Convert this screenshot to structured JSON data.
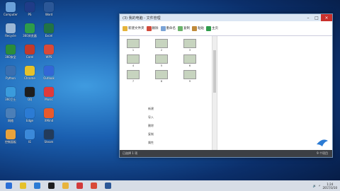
{
  "desktop": {
    "icons": [
      {
        "label": "Computer",
        "color": "#6aa0d9"
      },
      {
        "label": "Recycle",
        "color": "#9bb7d6"
      },
      {
        "label": "360安全",
        "color": "#2a8c3c"
      },
      {
        "label": "Python",
        "color": "#3a6fb0"
      },
      {
        "label": "360卫士",
        "color": "#3a9bdc"
      },
      {
        "label": "网络",
        "color": "#4b7fb8"
      },
      {
        "label": "控制面板",
        "color": "#e8a23c"
      },
      {
        "label": "PS",
        "color": "#1f3c88"
      },
      {
        "label": "360浏览器",
        "color": "#2d9c4b"
      },
      {
        "label": "Corel",
        "color": "#c23a2a"
      },
      {
        "label": "Chrome",
        "color": "#e5c12b"
      },
      {
        "label": "QQ",
        "color": "#1e1e1e"
      },
      {
        "label": "Edge",
        "color": "#2b7bd4"
      },
      {
        "label": "IE",
        "color": "#3b89d9"
      },
      {
        "label": "Word",
        "color": "#2b5797"
      },
      {
        "label": "Excel",
        "color": "#217346"
      },
      {
        "label": "WPS",
        "color": "#d94a38"
      },
      {
        "label": "Outlook",
        "color": "#3367d6"
      },
      {
        "label": "Music",
        "color": "#e03a3a"
      },
      {
        "label": "XMind",
        "color": "#e85a2c"
      },
      {
        "label": "Steam",
        "color": "#233b5a"
      }
    ]
  },
  "window": {
    "title": "(3) 我的电脑 - 文件管理",
    "toolbar": [
      {
        "label": "新建文件夹",
        "color": "#e5b33a"
      },
      {
        "label": "删除",
        "color": "#d24a3a"
      },
      {
        "label": "重命名",
        "color": "#7aa3d6"
      },
      {
        "label": "复制",
        "color": "#6bb36b"
      },
      {
        "label": "粘贴",
        "color": "#c08a3a"
      },
      {
        "label": "主页",
        "color": "#2e9c4b"
      }
    ],
    "thumbs": [
      "1",
      "2",
      "3",
      "4",
      "5",
      "6",
      "7",
      "8",
      "9"
    ],
    "menu": [
      "新建",
      "导入",
      "删除",
      "复制",
      "属性"
    ],
    "status_left": "已选择 1 项",
    "status_right": "9 个项目"
  },
  "taskbar": {
    "apps": [
      {
        "name": "start",
        "color": "#2b6fd6"
      },
      {
        "name": "chrome",
        "color": "#e5c12b"
      },
      {
        "name": "edge",
        "color": "#2b7bd4"
      },
      {
        "name": "qq",
        "color": "#1e1e1e"
      },
      {
        "name": "explorer",
        "color": "#e8b43c"
      },
      {
        "name": "music",
        "color": "#d23a3a"
      },
      {
        "name": "wps",
        "color": "#d94a38"
      },
      {
        "name": "word",
        "color": "#2b5797"
      }
    ],
    "time": "1:24",
    "date": "2017/3/10"
  }
}
